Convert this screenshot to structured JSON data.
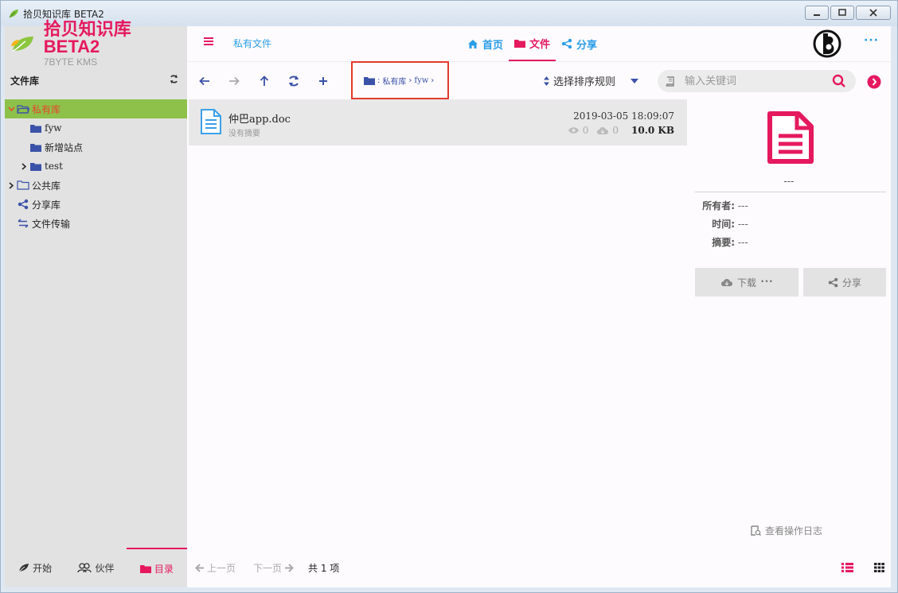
{
  "window": {
    "title": "拾贝知识库 BETA2"
  },
  "brand": {
    "name": "拾贝知识库 BETA2",
    "subtitle": "7BYTE KMS"
  },
  "sidebar": {
    "header": "文件库",
    "tree": [
      {
        "label": "私有库",
        "level": 0,
        "expanded": true,
        "active": true
      },
      {
        "label": "fyw",
        "level": 1
      },
      {
        "label": "新增站点",
        "level": 1
      },
      {
        "label": "test",
        "level": 1,
        "collapsed": true
      },
      {
        "label": "公共库",
        "level": 0,
        "collapsed": true
      },
      {
        "label": "分享库",
        "level": 0
      },
      {
        "label": "文件传输",
        "level": 0
      }
    ],
    "footer_tabs": [
      {
        "label": "开始"
      },
      {
        "label": "伙伴"
      },
      {
        "label": "目录",
        "active": true
      }
    ]
  },
  "header": {
    "section": "私有文件",
    "tabs": [
      {
        "label": "首页"
      },
      {
        "label": "文件",
        "active": true
      },
      {
        "label": "分享"
      }
    ],
    "more": "···"
  },
  "toolbar": {
    "path": [
      "私有库",
      "fyw"
    ],
    "sort_label": "选择排序规则",
    "search_placeholder": "输入关键词"
  },
  "files": [
    {
      "name": "仲巴app.doc",
      "summary": "没有摘要",
      "time": "2019-03-05 18:09:07",
      "views": "0",
      "downloads": "0",
      "size": "10.0 KB"
    }
  ],
  "detail": {
    "name": "---",
    "owner_label": "所有者:",
    "owner": "---",
    "time_label": "时间:",
    "time": "---",
    "summary_label": "摘要:",
    "summary": "---",
    "download_label": "下载",
    "download_more": "•••",
    "share_label": "分享",
    "oplog_label": "查看操作日志"
  },
  "pager": {
    "prev": "上一页",
    "next": "下一页",
    "count": "共 1 项"
  },
  "colors": {
    "accent": "#e5195e",
    "link": "#2a9de8",
    "active_tree_bg": "#8dc14a",
    "highlight_border": "#e43a2c"
  }
}
